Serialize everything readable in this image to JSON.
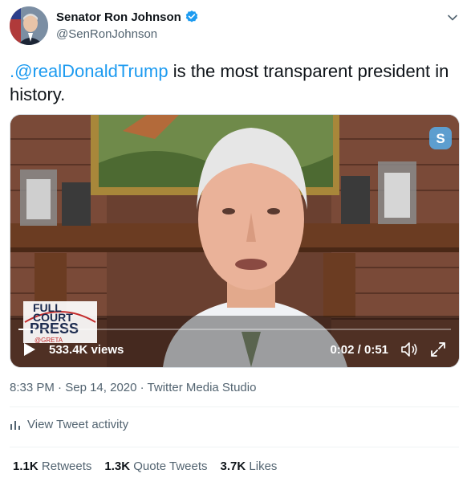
{
  "author": {
    "display_name": "Senator Ron Johnson",
    "handle": "@SenRonJohnson",
    "verified_icon": "verified-badge-icon",
    "avatar_icon": "avatar"
  },
  "tweet": {
    "mention": ".@realDonaldTrump",
    "text_rest": " is the most transparent president in history."
  },
  "video": {
    "views": "533.4K views",
    "time": "0:02 / 0:51",
    "progress": 0.039,
    "logo": {
      "line1": "FULL",
      "line2": "COURT",
      "line3": "PRESS",
      "tag": "@GRETA"
    }
  },
  "meta": {
    "time": "8:33 PM",
    "date": "Sep 14, 2020",
    "source": "Twitter Media Studio",
    "separator": "·"
  },
  "activity": {
    "label": "View Tweet activity"
  },
  "stats": [
    {
      "count": "1.1K",
      "label": "Retweets"
    },
    {
      "count": "1.3K",
      "label": "Quote Tweets"
    },
    {
      "count": "3.7K",
      "label": "Likes"
    }
  ],
  "colors": {
    "link": "#1d9bf0",
    "muted": "#536471",
    "text": "#0f1419"
  }
}
